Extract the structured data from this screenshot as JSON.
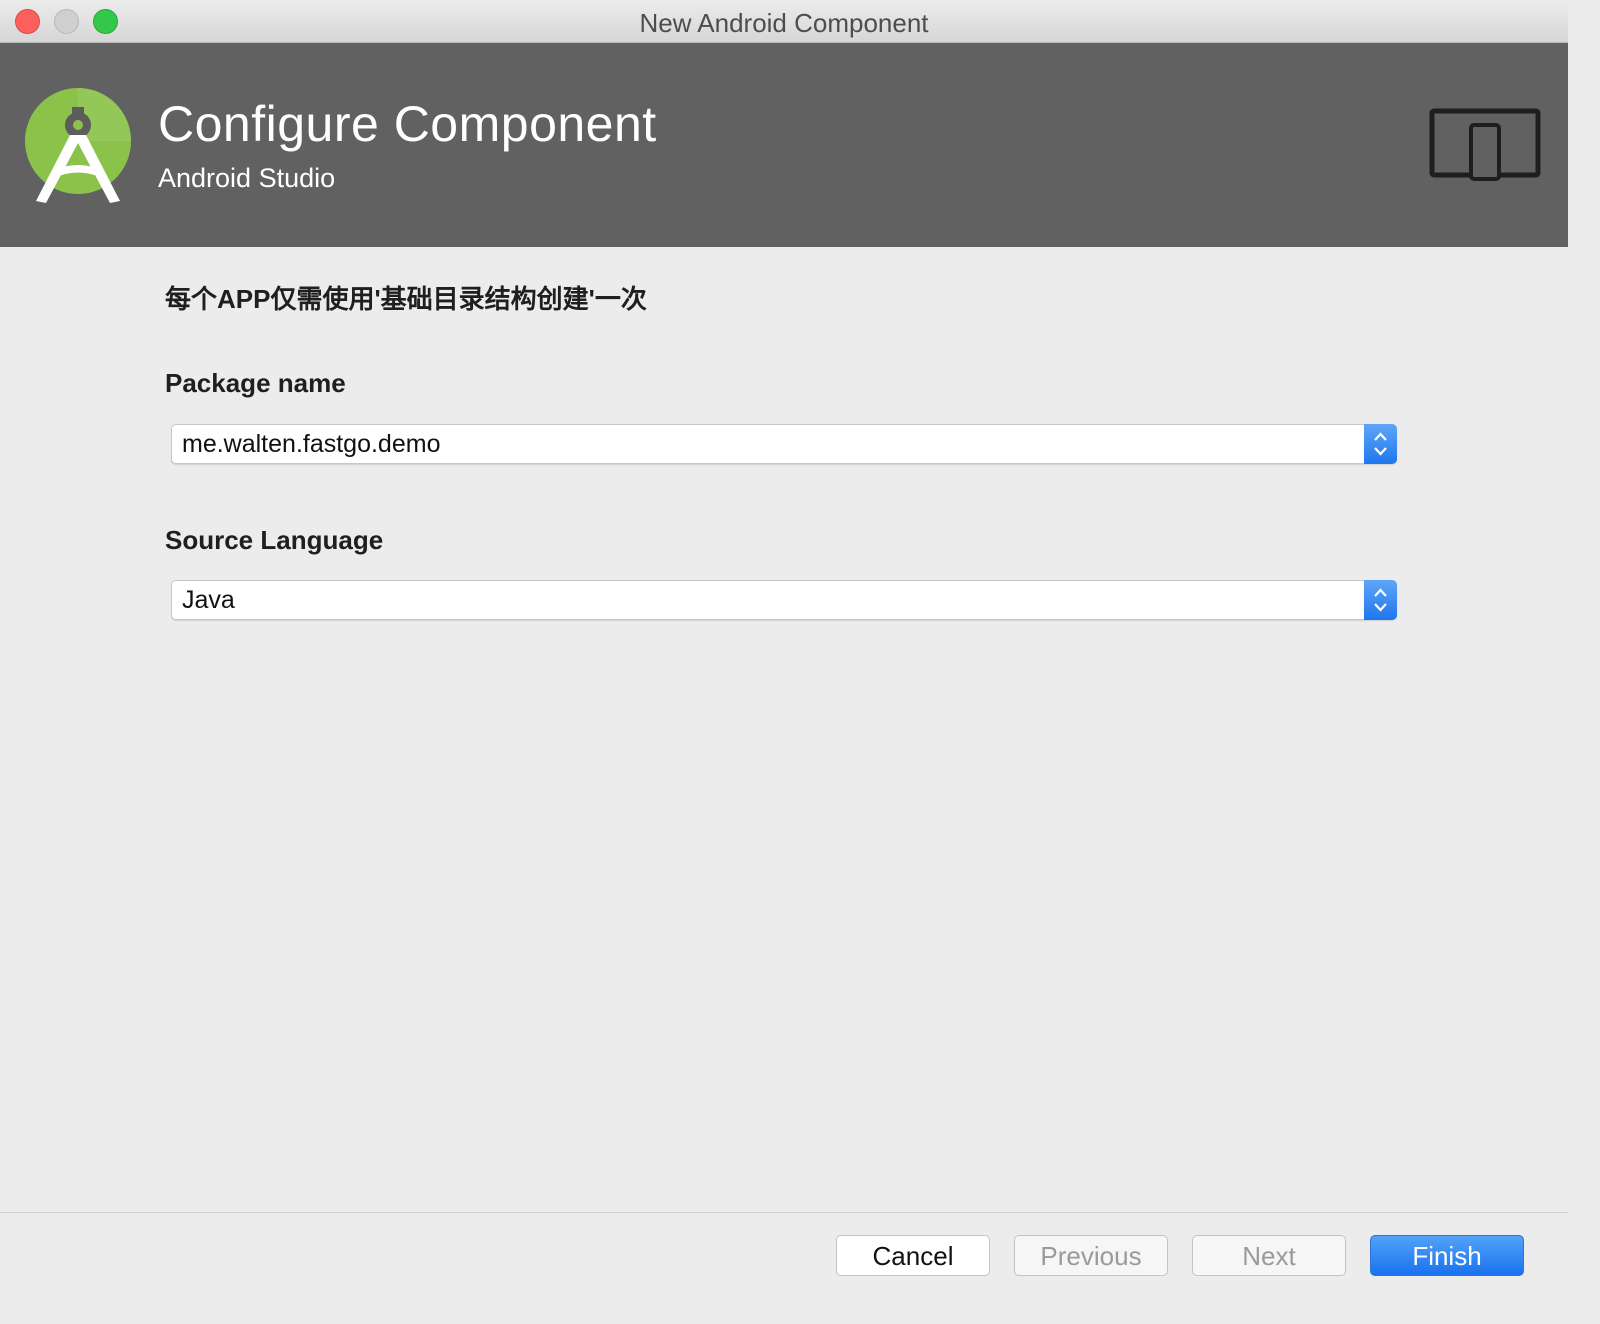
{
  "window": {
    "title": "New Android Component"
  },
  "header": {
    "title": "Configure Component",
    "subtitle": "Android Studio",
    "icons": [
      "android-studio-logo",
      "device-form-factor-icon"
    ]
  },
  "form": {
    "note": "每个APP仅需使用'基础目录结构创建'一次",
    "package_label": "Package name",
    "package_value": "me.walten.fastgo.demo",
    "language_label": "Source Language",
    "language_value": "Java"
  },
  "footer": {
    "cancel_label": "Cancel",
    "previous_label": "Previous",
    "next_label": "Next",
    "finish_label": "Finish"
  },
  "colors": {
    "banner": "#616161",
    "accent": "#1a72ef",
    "logo_green": "#8bc34a"
  }
}
